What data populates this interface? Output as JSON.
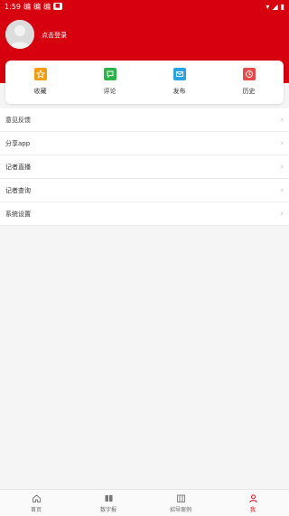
{
  "status": {
    "time": "1:59",
    "notifs": [
      "编",
      "编",
      "编"
    ]
  },
  "colors": {
    "brand": "#d6000f",
    "favorites": "#f39c12",
    "comments": "#2db34a",
    "publish": "#2aa4e0",
    "history": "#e74a4a"
  },
  "profile": {
    "login": "点击登录"
  },
  "shortcuts": [
    {
      "label": "收藏",
      "icon": "star-icon"
    },
    {
      "label": "评论",
      "icon": "comment-icon"
    },
    {
      "label": "发布",
      "icon": "mail-icon"
    },
    {
      "label": "历史",
      "icon": "clock-icon"
    }
  ],
  "menu": [
    {
      "label": "意见反馈"
    },
    {
      "label": "分享app"
    },
    {
      "label": "记者直播"
    },
    {
      "label": "记者查询"
    },
    {
      "label": "系统设置"
    }
  ],
  "tabs": [
    {
      "label": "首页",
      "icon": "home-icon"
    },
    {
      "label": "数字报",
      "icon": "newspaper-icon"
    },
    {
      "label": "招导案例",
      "icon": "building-icon"
    },
    {
      "label": "我",
      "icon": "profile-icon",
      "active": true
    }
  ]
}
